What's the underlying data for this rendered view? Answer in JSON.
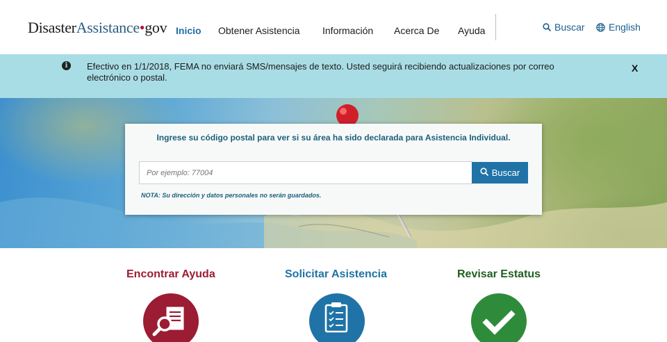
{
  "logo": {
    "part1": "Disaster",
    "part2": "Assistance",
    "dot": "•",
    "part3": "gov"
  },
  "nav": {
    "items": [
      {
        "label": "Inicio"
      },
      {
        "label": "Obtener Asistencia"
      },
      {
        "label": "Información"
      },
      {
        "label": "Acerca De"
      },
      {
        "label": "Ayuda"
      }
    ],
    "search_label": "Buscar",
    "language_label": "English"
  },
  "alert": {
    "message": "Efectivo en 1/1/2018, FEMA no enviará SMS/mensajes de texto. Usted seguirá recibiendo actualizaciones por correo electrónico o postal.",
    "close_label": "X"
  },
  "search": {
    "prompt": "Ingrese su código postal para ver si su área ha sido declarada para Asistencia Individual.",
    "placeholder": "Por ejemplo: 77004",
    "button_label": "Buscar",
    "note": "NOTA: Su dirección y datos personales no serán guardados."
  },
  "features": [
    {
      "title": "Encontrar Ayuda",
      "color": "#9b1c33",
      "icon": "search-document-icon"
    },
    {
      "title": "Solicitar Asistencia",
      "color": "#1f73a6",
      "icon": "clipboard-checklist-icon"
    },
    {
      "title": "Revisar Estatus",
      "color": "#2e8b3a",
      "title_color": "#1f5f22",
      "icon": "checkmark-icon"
    }
  ],
  "colors": {
    "accent": "#1f73a6",
    "alert_bg": "#a9dde6",
    "brand_red": "#b3143b"
  }
}
